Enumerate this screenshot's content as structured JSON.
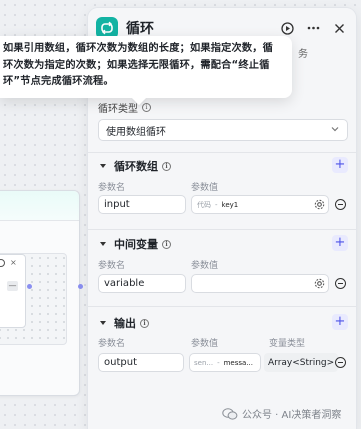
{
  "tooltip": {
    "text": "如果引用数组，循环次数为数组的长度；如果指定次数，循\n环次数为指定的次数；如果选择无限循环，需配合“终止循\n环”节点完成循环流程。"
  },
  "panel": {
    "title": "循环",
    "tabs_fragment": "务",
    "loop_type": {
      "label": "循环类型",
      "value": "使用数组循环"
    },
    "loop_array": {
      "title": "循环数组",
      "col_name": "参数名",
      "col_value": "参数值",
      "rows": [
        {
          "name": "input",
          "ref_prefix": "代码",
          "ref_sep": "-",
          "ref_value": "key1"
        }
      ]
    },
    "mid_vars": {
      "title": "中间变量",
      "col_name": "参数名",
      "col_value": "参数值",
      "rows": [
        {
          "name": "variable",
          "value": ""
        }
      ]
    },
    "output": {
      "title": "输出",
      "col_name": "参数名",
      "col_value": "参数值",
      "col_type": "变量类型",
      "rows": [
        {
          "name": "output",
          "ref_prefix": "sen...",
          "ref_sep": "-",
          "ref_value": "messa...",
          "type": "Array<String>"
        }
      ]
    }
  },
  "canvas": {
    "mini_close": "×",
    "mini_btn": "—"
  },
  "watermark": {
    "text": "公众号 · AI决策者洞察"
  },
  "colors": {
    "accent": "#4d53e8",
    "loop_badge": "#13b3a3",
    "panel_bg": "#f5f6f8"
  }
}
